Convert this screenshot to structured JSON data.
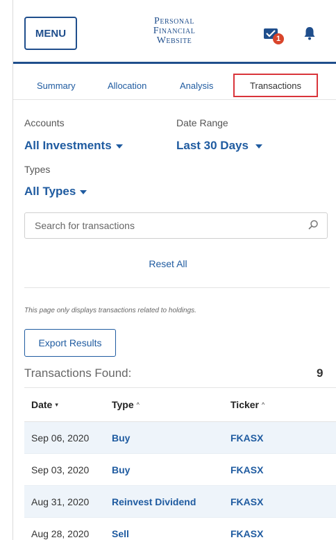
{
  "header": {
    "menu_label": "MENU",
    "site_title": [
      "Personal",
      "Financial",
      "Website"
    ],
    "notification_count": "1"
  },
  "tabs": [
    {
      "label": "Summary",
      "active": false
    },
    {
      "label": "Allocation",
      "active": false
    },
    {
      "label": "Analysis",
      "active": false
    },
    {
      "label": "Transactions",
      "active": true
    }
  ],
  "filters": {
    "accounts_label": "Accounts",
    "accounts_value": "All Investments",
    "date_range_label": "Date Range",
    "date_range_value": "Last 30 Days",
    "types_label": "Types",
    "types_value": "All Types"
  },
  "search": {
    "placeholder": "Search for transactions"
  },
  "reset_label": "Reset All",
  "note": "This page only displays transactions related to holdings.",
  "export_label": "Export Results",
  "results": {
    "found_label": "Transactions Found:",
    "count": "9"
  },
  "table": {
    "columns": [
      {
        "label": "Date",
        "sort": "▾"
      },
      {
        "label": "Type",
        "sort": "^"
      },
      {
        "label": "Ticker",
        "sort": "^"
      }
    ],
    "rows": [
      {
        "date": "Sep 06, 2020",
        "type": "Buy",
        "ticker": "FKASX"
      },
      {
        "date": "Sep 03, 2020",
        "type": "Buy",
        "ticker": "FKASX"
      },
      {
        "date": "Aug 31, 2020",
        "type": "Reinvest Dividend",
        "ticker": "FKASX"
      },
      {
        "date": "Aug 28, 2020",
        "type": "Sell",
        "ticker": "FKASX"
      }
    ]
  },
  "colors": {
    "brand": "#1f4e8c",
    "link": "#1f5ba0",
    "active_tab_border": "#d9343a",
    "badge": "#d9452b",
    "row_shade": "#eef4fa"
  },
  "icons": [
    "envelope-check-icon",
    "bell-icon",
    "search-icon",
    "caret-down-icon"
  ]
}
